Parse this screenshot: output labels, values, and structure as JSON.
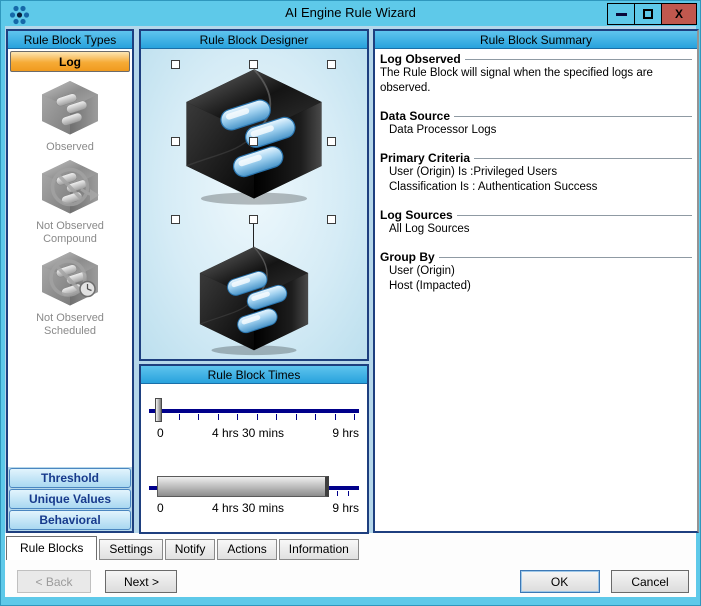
{
  "window": {
    "title": "AI Engine Rule Wizard",
    "controls": {
      "close_glyph": "X"
    }
  },
  "left_panel": {
    "header": "Rule Block Types",
    "log_button": "Log",
    "type_items": [
      {
        "label": "Observed",
        "icon": "observed-cube-icon"
      },
      {
        "label": "Not Observed Compound",
        "icon": "not-observed-compound-icon"
      },
      {
        "label": "Not Observed Scheduled",
        "icon": "not-observed-scheduled-icon"
      }
    ],
    "bottom_buttons": [
      "Threshold",
      "Unique Values",
      "Behavioral"
    ]
  },
  "designer": {
    "header": "Rule Block Designer"
  },
  "times": {
    "header": "Rule Block Times",
    "sliders": [
      {
        "labels": [
          "0",
          "4 hrs 30 mins",
          "9 hrs"
        ]
      },
      {
        "labels": [
          "0",
          "4 hrs 30 mins",
          "9 hrs"
        ]
      }
    ]
  },
  "summary": {
    "header": "Rule Block Summary",
    "sections": [
      {
        "title": "Log Observed",
        "lines": [
          "The Rule Block will signal when the specified logs are observed."
        ]
      },
      {
        "title": "Data Source",
        "lines": [
          "Data Processor Logs"
        ]
      },
      {
        "title": "Primary Criteria",
        "lines": [
          "User (Origin) Is :Privileged Users",
          "Classification Is : Authentication Success"
        ]
      },
      {
        "title": "Log Sources",
        "lines": [
          "All Log Sources"
        ]
      },
      {
        "title": "Group By",
        "lines": [
          "User (Origin)",
          "Host (Impacted)"
        ]
      }
    ]
  },
  "tabs": {
    "items": [
      "Rule Blocks",
      "Settings",
      "Notify",
      "Actions",
      "Information"
    ],
    "active": "Rule Blocks"
  },
  "footer": {
    "back": "< Back",
    "next": "Next >",
    "ok": "OK",
    "cancel": "Cancel"
  },
  "colors": {
    "titlebar": "#5EC9E9",
    "panel_header": "#2FA8E1",
    "panel_border": "#1E3F7F",
    "log_button": "#F6AB36",
    "close_button": "#C0584E",
    "slider_track": "#00008B",
    "type_buttons": "#A9D8F1"
  }
}
